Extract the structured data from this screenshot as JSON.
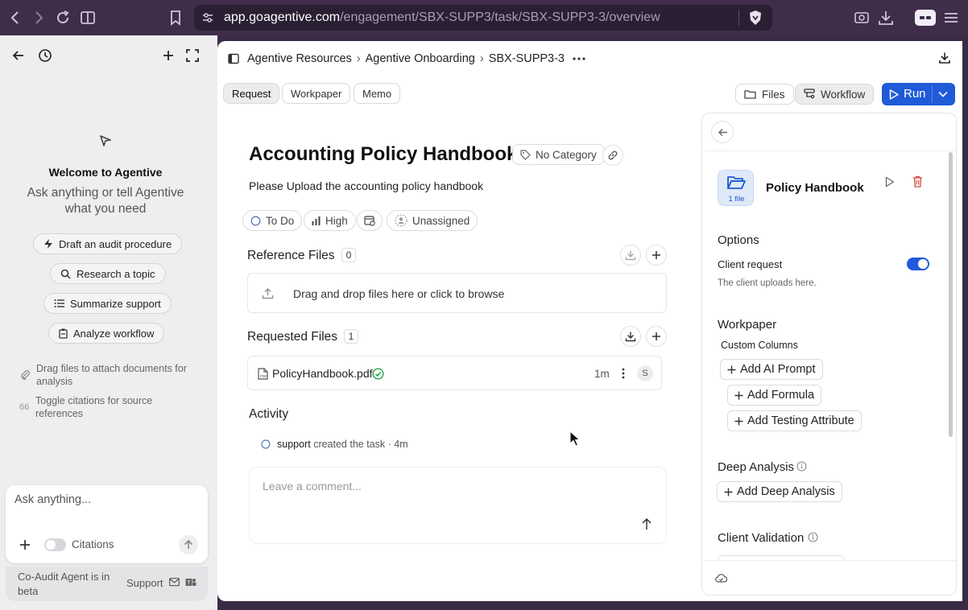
{
  "browser": {
    "url_host": "app.goagentive.com",
    "url_path": "/engagement/SBX-SUPP3/task/SBX-SUPP3-3/overview"
  },
  "assistant": {
    "welcome_title": "Welcome to Agentive",
    "welcome_subtitle": "Ask anything or tell Agentive what you need",
    "suggestions": [
      {
        "label": "Draft an audit procedure",
        "icon": "bolt-icon"
      },
      {
        "label": "Research a topic",
        "icon": "search-icon"
      },
      {
        "label": "Summarize support",
        "icon": "list-icon"
      },
      {
        "label": "Analyze workflow",
        "icon": "clipboard-icon"
      }
    ],
    "hints": [
      {
        "text": "Drag files to attach documents for analysis",
        "icon": "paperclip-icon"
      },
      {
        "text": "Toggle citations for source references",
        "icon": "quote-icon"
      }
    ],
    "input_placeholder": "Ask anything...",
    "citations_label": "Citations",
    "beta_text": "Co-Audit Agent is in beta",
    "support_label": "Support"
  },
  "breadcrumb": [
    "Agentive Resources",
    "Agentive Onboarding",
    "SBX-SUPP3-3"
  ],
  "tabs": [
    {
      "label": "Request",
      "active": true
    },
    {
      "label": "Workpaper",
      "active": false
    },
    {
      "label": "Memo",
      "active": false
    }
  ],
  "toolbar": {
    "files_label": "Files",
    "workflow_label": "Workflow",
    "run_label": "Run"
  },
  "task": {
    "title": "Accounting Policy Handbook",
    "category": "No Category",
    "description": "Please Upload the accounting policy handbook",
    "status": "To Do",
    "priority": "High",
    "assignee": "Unassigned"
  },
  "reference_files": {
    "title": "Reference Files",
    "count": "0",
    "dropzone_text": "Drag and drop files here or click to browse"
  },
  "requested_files": {
    "title": "Requested Files",
    "count": "1",
    "files": [
      {
        "name": "PolicyHandbook.pdf",
        "age": "1m",
        "avatar": "S"
      }
    ]
  },
  "activity": {
    "title": "Activity",
    "entries": [
      {
        "user": "support",
        "action": "created the task",
        "time": "4m"
      }
    ],
    "comment_placeholder": "Leave a comment..."
  },
  "panel": {
    "item_name": "Policy Handbook",
    "file_count": "1 file",
    "options_title": "Options",
    "client_request_label": "Client request",
    "client_request_on": true,
    "client_request_help": "The client uploads here.",
    "workpaper_title": "Workpaper",
    "custom_columns_label": "Custom Columns",
    "add_ai_prompt": "Add AI Prompt",
    "add_formula": "Add Formula",
    "add_testing_attribute": "Add Testing Attribute",
    "deep_analysis_title": "Deep Analysis",
    "add_deep_analysis": "Add Deep Analysis",
    "client_validation_title": "Client Validation"
  },
  "colors": {
    "accent": "#1f5bd8",
    "success": "#22a447",
    "chrome": "#3f2d4a"
  }
}
